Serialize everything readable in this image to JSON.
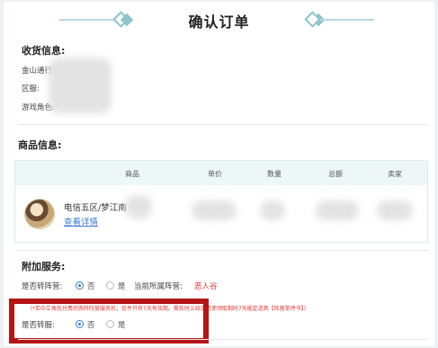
{
  "header": {
    "title": "确认订单"
  },
  "shipping": {
    "title": "收货信息:",
    "fields": [
      {
        "label": "金山通行证:"
      },
      {
        "label": "区服:"
      },
      {
        "label": "游戏角色:"
      }
    ]
  },
  "goods": {
    "title": "商品信息:",
    "columns": [
      "商品",
      "单价",
      "数量",
      "总额",
      "卖家"
    ],
    "item": {
      "name": "电信五区/梦江南",
      "detail_link": "查看详情"
    }
  },
  "services": {
    "title": "附加服务:",
    "camp_transfer": {
      "label": "是否转阵营:",
      "options": [
        "否",
        "是"
      ],
      "selected": "否",
      "current_camp_label": "当前所属阵营:",
      "current_camp_value": "恶人谷"
    },
    "note": "（*若中立角色付费后购转阵营服务后，信件只有7天有效期。需及时上线会信使领取剩时7天掘定道具【阵营单停书】）",
    "server_transfer": {
      "label": "是否转服:",
      "options": [
        "否",
        "是"
      ],
      "selected": "否"
    }
  },
  "colors": {
    "accent": "#3a7bd5",
    "warning": "#e53935",
    "highlight": "#b41414"
  }
}
